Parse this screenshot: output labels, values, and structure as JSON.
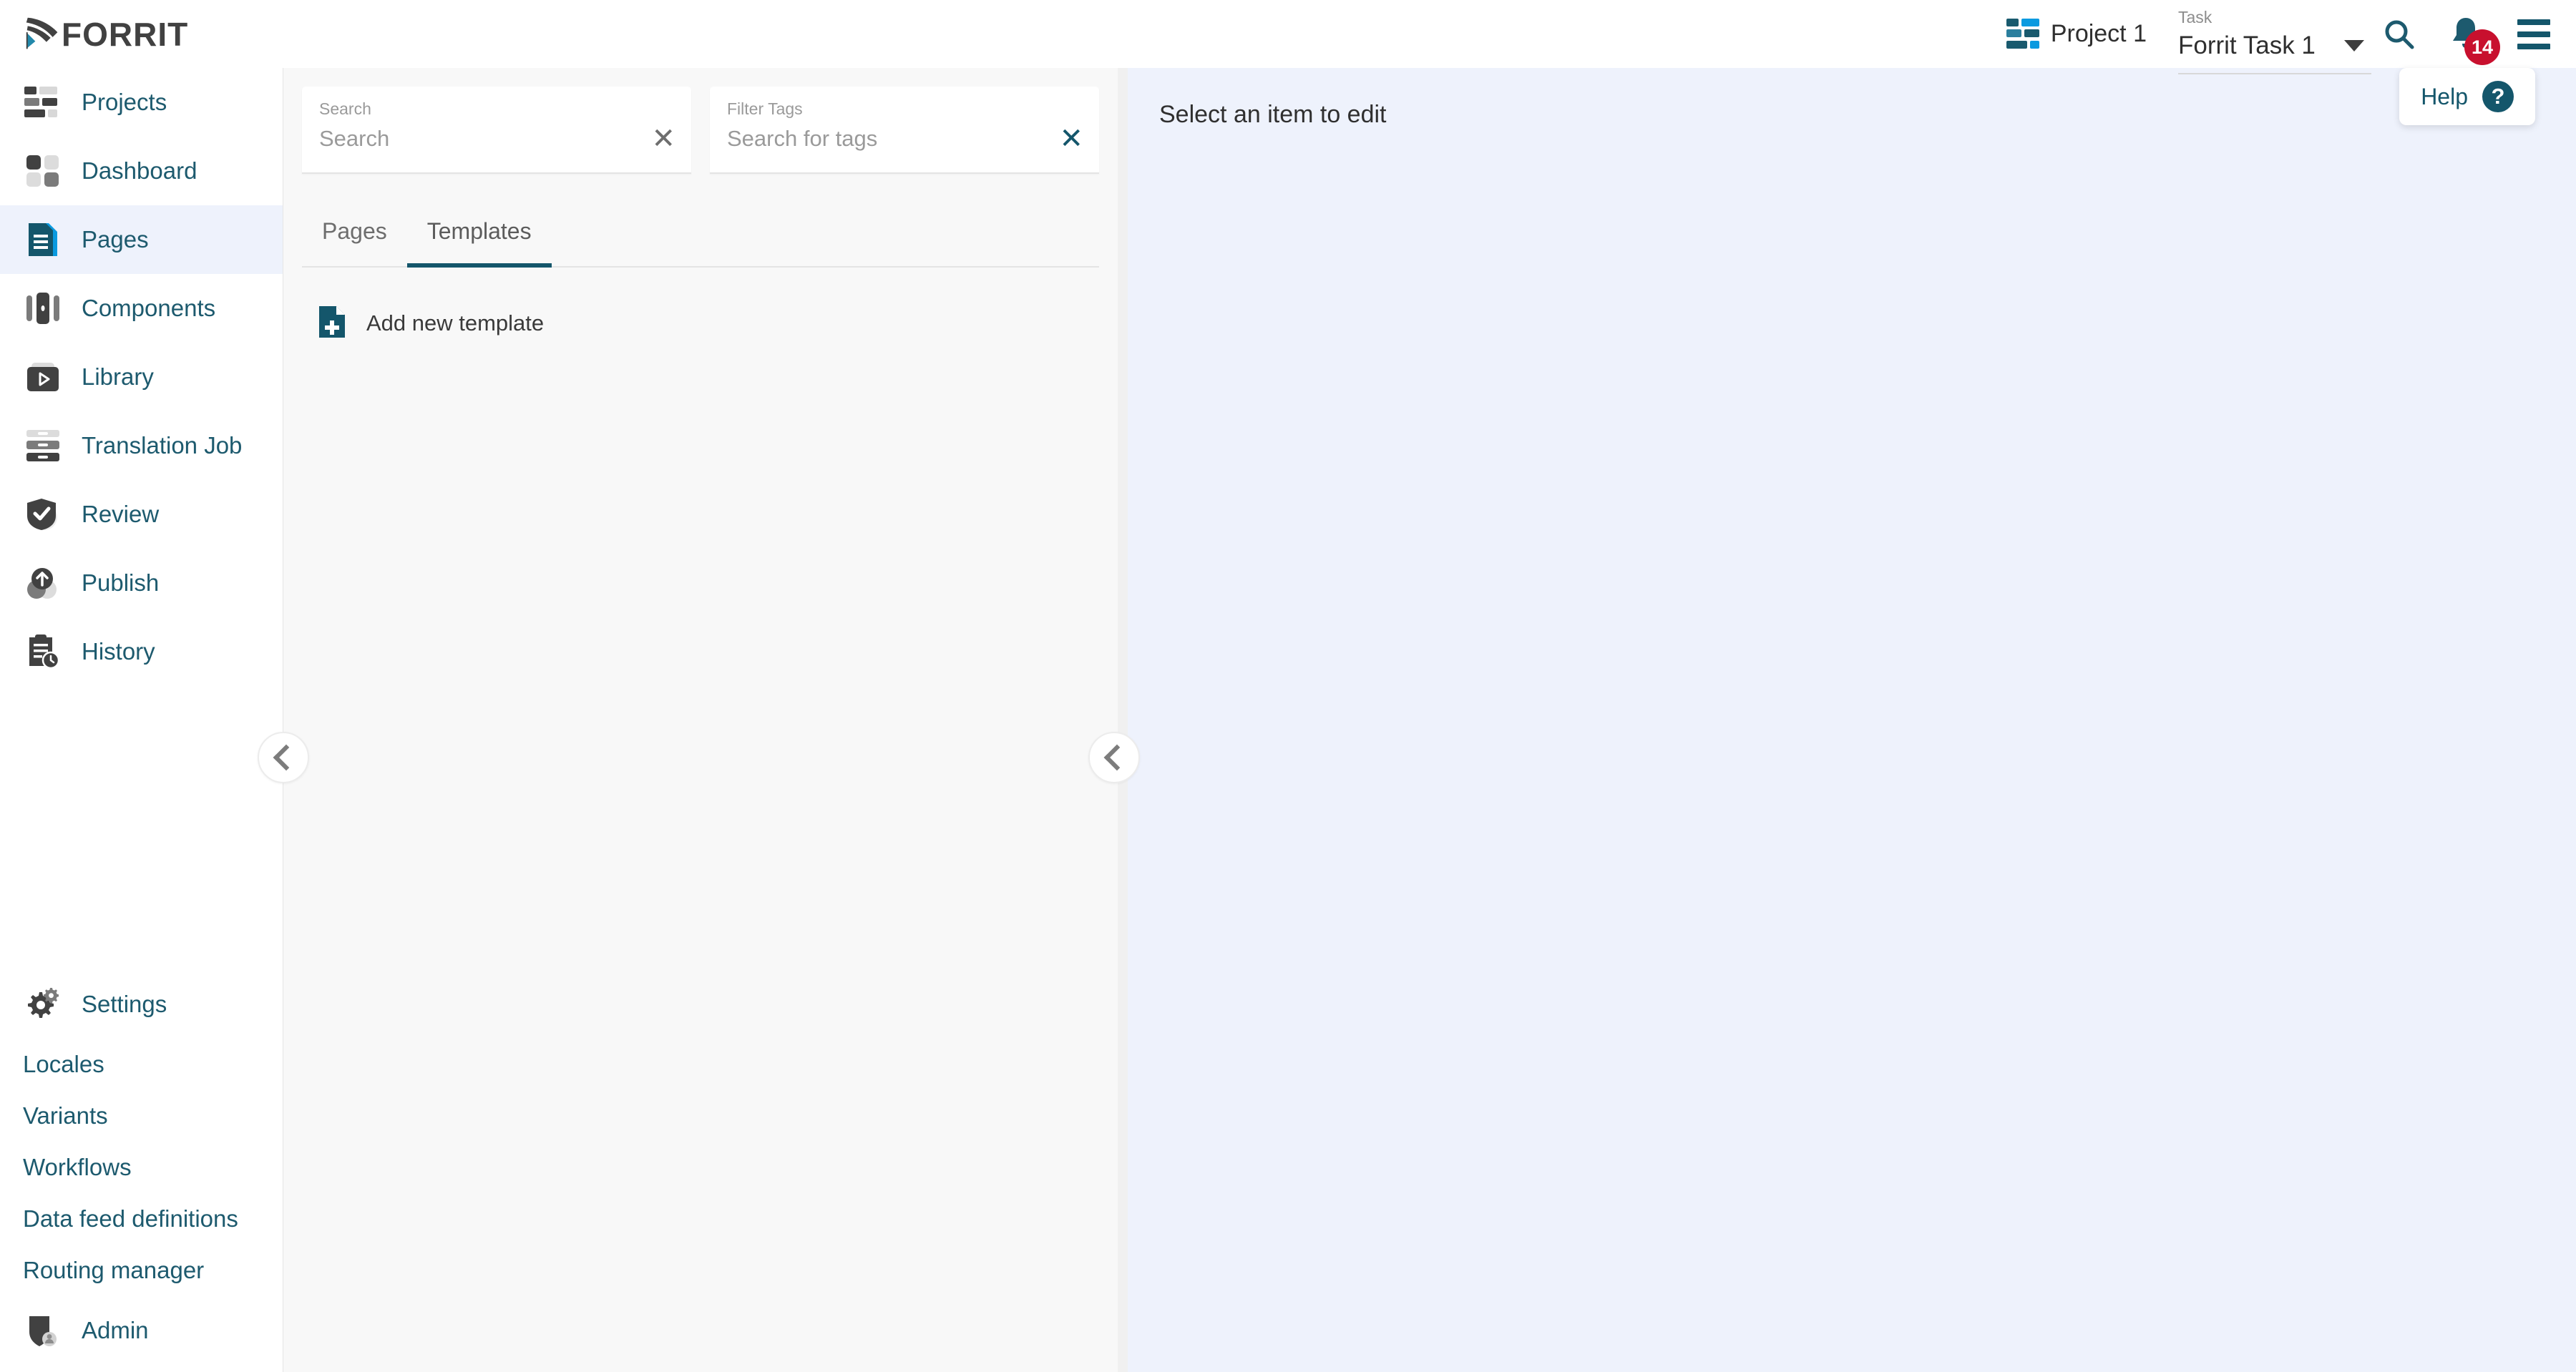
{
  "header": {
    "logo_text": "FORRIT",
    "logo_icon": "forrit-logo-icon",
    "project_icon": "project-grid-icon",
    "project_name": "Project 1",
    "task_label": "Task",
    "task_value": "Forrit Task 1",
    "dropdown_icon": "chevron-down-icon",
    "search_icon": "search-icon",
    "bell_icon": "bell-icon",
    "notification_count": "14",
    "menu_icon": "hamburger-menu-icon"
  },
  "help": {
    "label": "Help",
    "icon": "question-mark-icon"
  },
  "sidebar": {
    "items": [
      {
        "label": "Projects",
        "icon": "projects-icon",
        "active": false
      },
      {
        "label": "Dashboard",
        "icon": "dashboard-icon",
        "active": false
      },
      {
        "label": "Pages",
        "icon": "pages-document-icon",
        "active": true
      },
      {
        "label": "Components",
        "icon": "components-icon",
        "active": false
      },
      {
        "label": "Library",
        "icon": "library-play-icon",
        "active": false
      },
      {
        "label": "Translation Job",
        "icon": "translation-job-icon",
        "active": false
      },
      {
        "label": "Review",
        "icon": "review-shield-check-icon",
        "active": false
      },
      {
        "label": "Publish",
        "icon": "publish-upload-icon",
        "active": false
      },
      {
        "label": "History",
        "icon": "history-clipboard-clock-icon",
        "active": false
      }
    ],
    "settings": {
      "label": "Settings",
      "icon": "gear-icon"
    },
    "settings_items": [
      {
        "label": "Locales"
      },
      {
        "label": "Variants"
      },
      {
        "label": "Workflows"
      },
      {
        "label": "Data feed definitions"
      },
      {
        "label": "Routing manager"
      }
    ],
    "admin": {
      "label": "Admin",
      "icon": "admin-shield-user-icon"
    },
    "collapse_icon": "chevron-left-icon"
  },
  "mid_panel": {
    "search": {
      "label": "Search",
      "value": "",
      "placeholder": "Search",
      "clear_icon": "close-x-icon"
    },
    "filter_tags": {
      "label": "Filter Tags",
      "value": "",
      "placeholder": "Search for tags",
      "clear_icon": "close-x-icon"
    },
    "tabs": [
      {
        "label": "Pages",
        "active": false
      },
      {
        "label": "Templates",
        "active": true
      }
    ],
    "list": [
      {
        "label": "Add new template",
        "icon": "add-document-icon"
      }
    ],
    "collapse_icon": "chevron-left-icon"
  },
  "main": {
    "title": "Select an item to edit"
  },
  "colors": {
    "teal": "#14566b",
    "teal_text": "#1d5a6e",
    "accent_blue": "#0a9ae0",
    "badge_red": "#c8102e",
    "active_bg": "#eef2fc",
    "mid_panel_bg": "#f8f8f8",
    "icon_dark": "#414141"
  }
}
